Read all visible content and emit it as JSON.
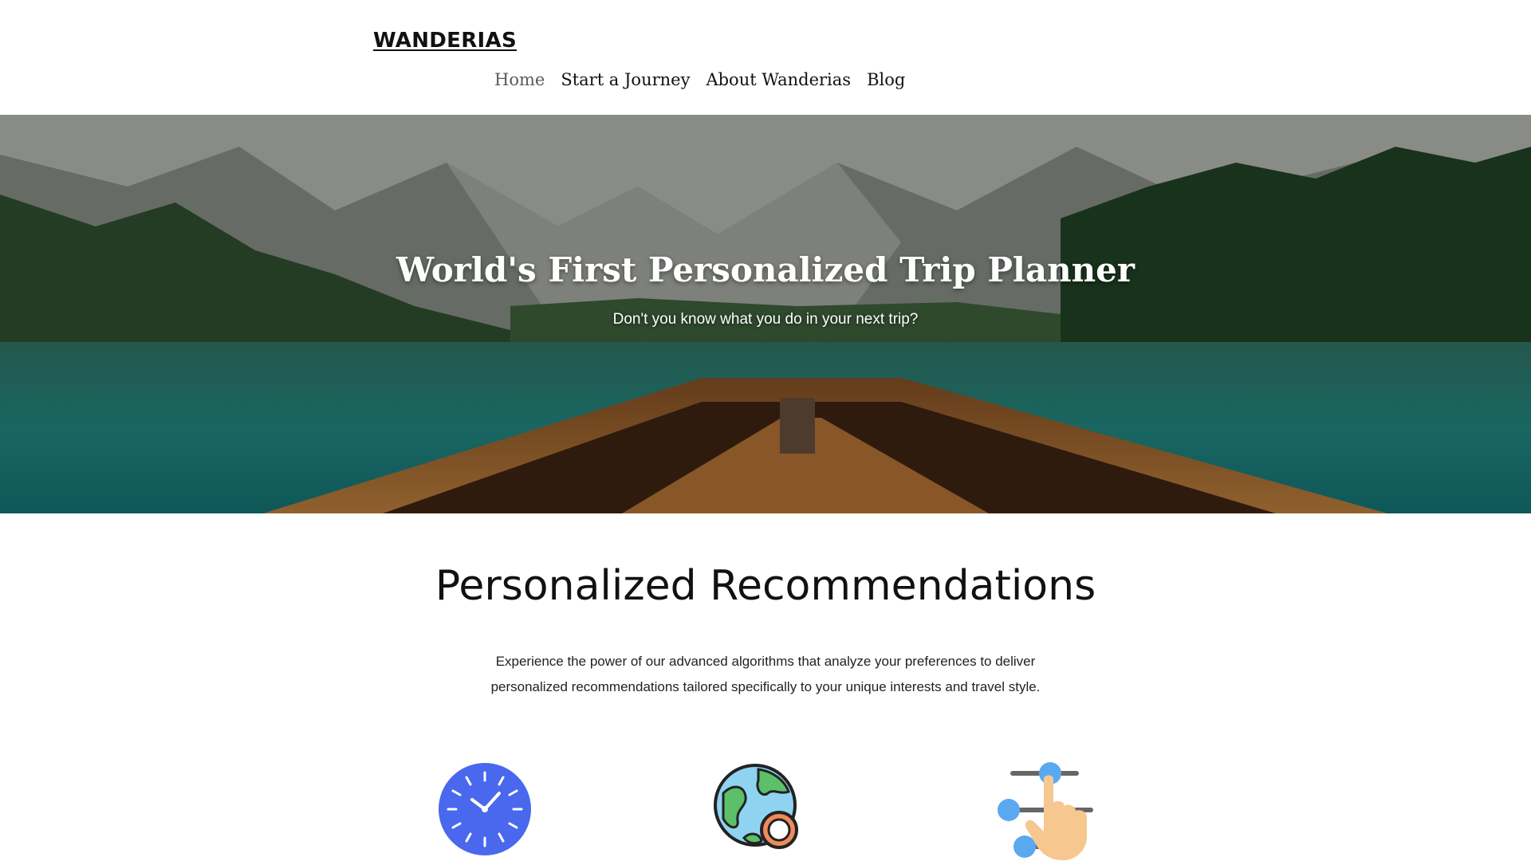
{
  "header": {
    "logo": "WANDERIAS",
    "nav": [
      {
        "label": "Home",
        "active": true
      },
      {
        "label": "Start a Journey",
        "active": false
      },
      {
        "label": "About Wanderias",
        "active": false
      },
      {
        "label": "Blog",
        "active": false
      }
    ]
  },
  "hero": {
    "title": "World's First Personalized Trip Planner",
    "subtitle": "Don't you know what you do in your next trip?"
  },
  "section": {
    "title": "Personalized Recommendations",
    "body": "Experience the power of our advanced algorithms that analyze your preferences  to deliver personalized recommendations tailored specifically to your unique interests and travel style."
  },
  "features": [
    {
      "icon": "clock-icon"
    },
    {
      "icon": "globe-search-icon"
    },
    {
      "icon": "hand-sliders-icon"
    }
  ],
  "colors": {
    "clock_blue": "#4a68ee",
    "globe_water": "#8fd3f0",
    "globe_land": "#5cbf6a",
    "accent_orange": "#f08a5d",
    "slider_blue": "#5aa9f0",
    "skin": "#f6c78f"
  }
}
